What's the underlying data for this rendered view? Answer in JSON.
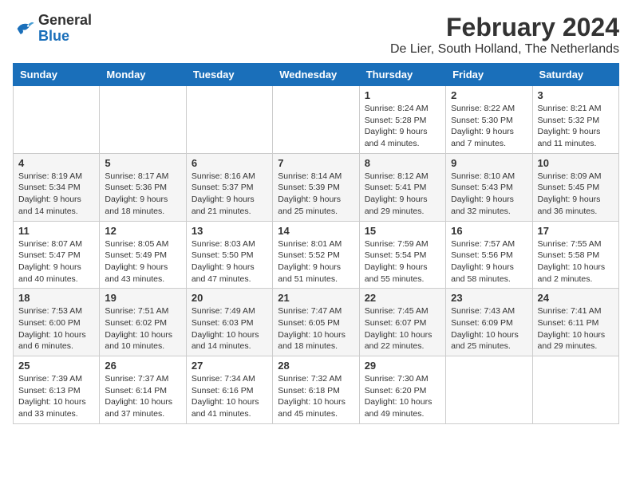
{
  "logo": {
    "general": "General",
    "blue": "Blue"
  },
  "header": {
    "month_year": "February 2024",
    "location": "De Lier, South Holland, The Netherlands"
  },
  "weekdays": [
    "Sunday",
    "Monday",
    "Tuesday",
    "Wednesday",
    "Thursday",
    "Friday",
    "Saturday"
  ],
  "weeks": [
    [
      {
        "day": "",
        "info": ""
      },
      {
        "day": "",
        "info": ""
      },
      {
        "day": "",
        "info": ""
      },
      {
        "day": "",
        "info": ""
      },
      {
        "day": "1",
        "info": "Sunrise: 8:24 AM\nSunset: 5:28 PM\nDaylight: 9 hours\nand 4 minutes."
      },
      {
        "day": "2",
        "info": "Sunrise: 8:22 AM\nSunset: 5:30 PM\nDaylight: 9 hours\nand 7 minutes."
      },
      {
        "day": "3",
        "info": "Sunrise: 8:21 AM\nSunset: 5:32 PM\nDaylight: 9 hours\nand 11 minutes."
      }
    ],
    [
      {
        "day": "4",
        "info": "Sunrise: 8:19 AM\nSunset: 5:34 PM\nDaylight: 9 hours\nand 14 minutes."
      },
      {
        "day": "5",
        "info": "Sunrise: 8:17 AM\nSunset: 5:36 PM\nDaylight: 9 hours\nand 18 minutes."
      },
      {
        "day": "6",
        "info": "Sunrise: 8:16 AM\nSunset: 5:37 PM\nDaylight: 9 hours\nand 21 minutes."
      },
      {
        "day": "7",
        "info": "Sunrise: 8:14 AM\nSunset: 5:39 PM\nDaylight: 9 hours\nand 25 minutes."
      },
      {
        "day": "8",
        "info": "Sunrise: 8:12 AM\nSunset: 5:41 PM\nDaylight: 9 hours\nand 29 minutes."
      },
      {
        "day": "9",
        "info": "Sunrise: 8:10 AM\nSunset: 5:43 PM\nDaylight: 9 hours\nand 32 minutes."
      },
      {
        "day": "10",
        "info": "Sunrise: 8:09 AM\nSunset: 5:45 PM\nDaylight: 9 hours\nand 36 minutes."
      }
    ],
    [
      {
        "day": "11",
        "info": "Sunrise: 8:07 AM\nSunset: 5:47 PM\nDaylight: 9 hours\nand 40 minutes."
      },
      {
        "day": "12",
        "info": "Sunrise: 8:05 AM\nSunset: 5:49 PM\nDaylight: 9 hours\nand 43 minutes."
      },
      {
        "day": "13",
        "info": "Sunrise: 8:03 AM\nSunset: 5:50 PM\nDaylight: 9 hours\nand 47 minutes."
      },
      {
        "day": "14",
        "info": "Sunrise: 8:01 AM\nSunset: 5:52 PM\nDaylight: 9 hours\nand 51 minutes."
      },
      {
        "day": "15",
        "info": "Sunrise: 7:59 AM\nSunset: 5:54 PM\nDaylight: 9 hours\nand 55 minutes."
      },
      {
        "day": "16",
        "info": "Sunrise: 7:57 AM\nSunset: 5:56 PM\nDaylight: 9 hours\nand 58 minutes."
      },
      {
        "day": "17",
        "info": "Sunrise: 7:55 AM\nSunset: 5:58 PM\nDaylight: 10 hours\nand 2 minutes."
      }
    ],
    [
      {
        "day": "18",
        "info": "Sunrise: 7:53 AM\nSunset: 6:00 PM\nDaylight: 10 hours\nand 6 minutes."
      },
      {
        "day": "19",
        "info": "Sunrise: 7:51 AM\nSunset: 6:02 PM\nDaylight: 10 hours\nand 10 minutes."
      },
      {
        "day": "20",
        "info": "Sunrise: 7:49 AM\nSunset: 6:03 PM\nDaylight: 10 hours\nand 14 minutes."
      },
      {
        "day": "21",
        "info": "Sunrise: 7:47 AM\nSunset: 6:05 PM\nDaylight: 10 hours\nand 18 minutes."
      },
      {
        "day": "22",
        "info": "Sunrise: 7:45 AM\nSunset: 6:07 PM\nDaylight: 10 hours\nand 22 minutes."
      },
      {
        "day": "23",
        "info": "Sunrise: 7:43 AM\nSunset: 6:09 PM\nDaylight: 10 hours\nand 25 minutes."
      },
      {
        "day": "24",
        "info": "Sunrise: 7:41 AM\nSunset: 6:11 PM\nDaylight: 10 hours\nand 29 minutes."
      }
    ],
    [
      {
        "day": "25",
        "info": "Sunrise: 7:39 AM\nSunset: 6:13 PM\nDaylight: 10 hours\nand 33 minutes."
      },
      {
        "day": "26",
        "info": "Sunrise: 7:37 AM\nSunset: 6:14 PM\nDaylight: 10 hours\nand 37 minutes."
      },
      {
        "day": "27",
        "info": "Sunrise: 7:34 AM\nSunset: 6:16 PM\nDaylight: 10 hours\nand 41 minutes."
      },
      {
        "day": "28",
        "info": "Sunrise: 7:32 AM\nSunset: 6:18 PM\nDaylight: 10 hours\nand 45 minutes."
      },
      {
        "day": "29",
        "info": "Sunrise: 7:30 AM\nSunset: 6:20 PM\nDaylight: 10 hours\nand 49 minutes."
      },
      {
        "day": "",
        "info": ""
      },
      {
        "day": "",
        "info": ""
      }
    ]
  ]
}
